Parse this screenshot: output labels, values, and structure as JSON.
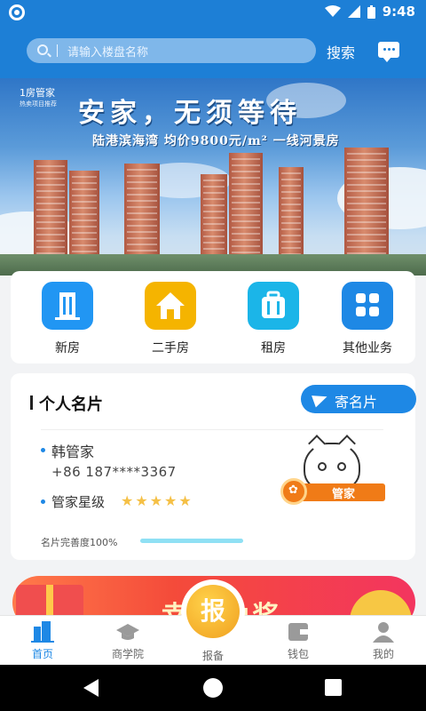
{
  "status_bar": {
    "time": "9:48"
  },
  "header": {
    "search_placeholder": "请输入楼盘名称",
    "search_button": "搜索"
  },
  "banner": {
    "logo": "1房管家",
    "logo_sub": "热卖项目推荐",
    "title": "安家，无须等待",
    "subtitle": "陆港滨海湾 均价9800元/m² 一线河景房"
  },
  "categories": [
    {
      "label": "新房",
      "icon": "building-icon",
      "color": "#2196f3"
    },
    {
      "label": "二手房",
      "icon": "house-icon",
      "color": "#f5b400"
    },
    {
      "label": "租房",
      "icon": "suitcase-icon",
      "color": "#1bb5e8"
    },
    {
      "label": "其他业务",
      "icon": "grid-icon",
      "color": "#1e88e5"
    }
  ],
  "profile_card": {
    "title": "个人名片",
    "send_button": "寄名片",
    "name": "韩管家",
    "phone": "+86  187****3367",
    "level_label": "管家星级",
    "stars": "★★★★★",
    "rating": 5,
    "badge": "管家",
    "completeness_label": "名片完善度100%",
    "completeness": 1.0
  },
  "promo": {
    "text": "幸运抽奖"
  },
  "tabbar": {
    "items": [
      {
        "label": "首页",
        "icon": "home-buildings-icon",
        "active": true
      },
      {
        "label": "商学院",
        "icon": "graduation-cap-icon",
        "active": false
      },
      {
        "label": "报备",
        "icon": "report-icon",
        "active": false
      },
      {
        "label": "钱包",
        "icon": "wallet-icon",
        "active": false
      },
      {
        "label": "我的",
        "icon": "user-icon",
        "active": false
      }
    ],
    "report_glyph": "报"
  },
  "colors": {
    "primary": "#1d7fd6",
    "accent": "#1e88e5",
    "star": "#f5c046",
    "badge": "#f07b17"
  }
}
